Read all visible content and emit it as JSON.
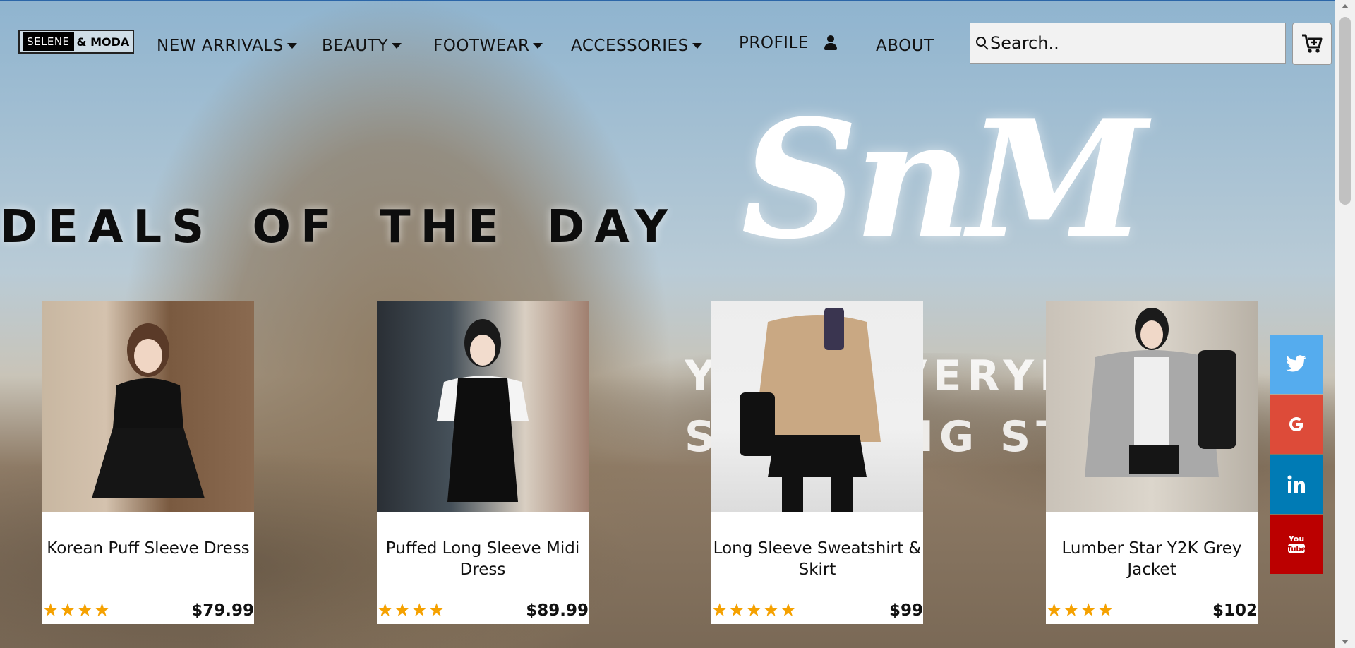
{
  "logo": {
    "part1": "SELENE",
    "part2": "& MODA"
  },
  "nav": {
    "new_arrivals": "NEW ARRIVALS",
    "beauty": "BEAUTY",
    "footwear": "FOOTWEAR",
    "accessories": "ACCESSORIES",
    "profile": "PROFILE",
    "about": "ABOUT"
  },
  "search": {
    "placeholder": "Search.."
  },
  "hero": {
    "deals_title": "DEALS OF THE DAY",
    "brand_script": "SnM",
    "tagline_line1": "YOUR EVERYDAY",
    "tagline_line2": "SHOPPING ST"
  },
  "products": [
    {
      "name": "Korean Puff Sleeve Dress",
      "price": "$79.99",
      "rating": 4,
      "stars": "★★★★"
    },
    {
      "name": "Puffed Long Sleeve Midi Dress",
      "price": "$89.99",
      "rating": 4,
      "stars": "★★★★"
    },
    {
      "name": "Long Sleeve Sweatshirt & Skirt",
      "price": "$99",
      "rating": 5,
      "stars": "★★★★★"
    },
    {
      "name": "Lumber Star Y2K Grey Jacket",
      "price": "$102",
      "rating": 4,
      "stars": "★★★★"
    }
  ],
  "social": {
    "twitter": "twitter-icon",
    "google": "google-icon",
    "linkedin": "linkedin-icon",
    "youtube": "youtube-icon"
  },
  "colors": {
    "star": "#f5a100",
    "twitter": "#55acee",
    "google": "#dd4b39",
    "linkedin": "#007bb5",
    "youtube": "#bb0000"
  }
}
